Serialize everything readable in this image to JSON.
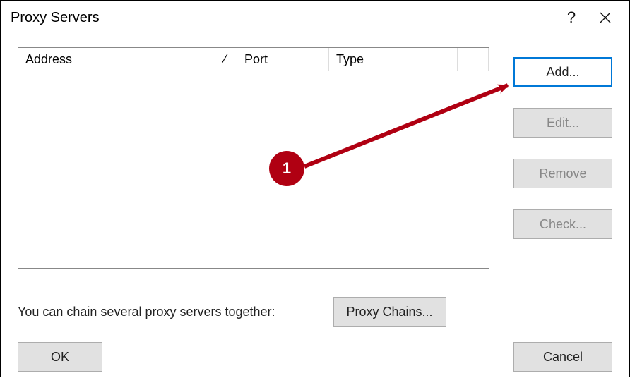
{
  "title": "Proxy Servers",
  "list": {
    "columns": {
      "address": "Address",
      "port": "Port",
      "type": "Type"
    }
  },
  "buttons": {
    "add": "Add...",
    "edit": "Edit...",
    "remove": "Remove",
    "check": "Check...",
    "proxy_chains": "Proxy Chains...",
    "ok": "OK",
    "cancel": "Cancel"
  },
  "hint": "You can chain several proxy servers together:",
  "annotation": {
    "step": "1"
  }
}
